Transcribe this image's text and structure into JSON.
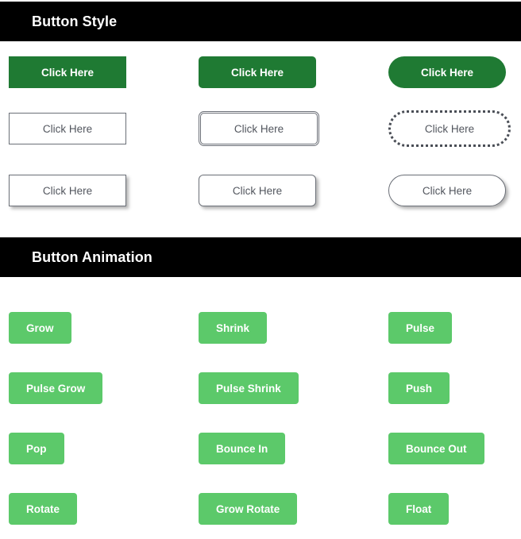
{
  "page": {
    "background": "#ffffff",
    "accent_dark_green": "#1f7a33",
    "accent_light_green": "#5cc96a",
    "header_background": "#000000",
    "header_text_color": "#ffffff",
    "outline_text_color": "#52565e"
  },
  "style_section": {
    "title": "Button Style",
    "rows": [
      {
        "name": "solid-row",
        "buttons": [
          {
            "label": "Click Here",
            "variant": "solid-square"
          },
          {
            "label": "Click Here",
            "variant": "solid-rounded"
          },
          {
            "label": "Click Here",
            "variant": "solid-pill"
          }
        ]
      },
      {
        "name": "outline-row",
        "buttons": [
          {
            "label": "Click Here",
            "variant": "outline-square"
          },
          {
            "label": "Click Here",
            "variant": "outline-double"
          },
          {
            "label": "Click Here",
            "variant": "outline-dotted-pill"
          }
        ]
      },
      {
        "name": "shadow-row",
        "buttons": [
          {
            "label": "Click Here",
            "variant": "shadow-square"
          },
          {
            "label": "Click Here",
            "variant": "shadow-rounded"
          },
          {
            "label": "Click Here",
            "variant": "shadow-pill"
          }
        ]
      }
    ]
  },
  "animation_section": {
    "title": "Button Animation",
    "rows": [
      {
        "buttons": [
          {
            "label": "Grow"
          },
          {
            "label": "Shrink"
          },
          {
            "label": "Pulse"
          }
        ]
      },
      {
        "buttons": [
          {
            "label": "Pulse Grow"
          },
          {
            "label": "Pulse Shrink"
          },
          {
            "label": "Push"
          }
        ]
      },
      {
        "buttons": [
          {
            "label": "Pop"
          },
          {
            "label": "Bounce In"
          },
          {
            "label": "Bounce Out"
          }
        ]
      },
      {
        "buttons": [
          {
            "label": "Rotate"
          },
          {
            "label": "Grow Rotate"
          },
          {
            "label": "Float"
          }
        ]
      }
    ]
  }
}
